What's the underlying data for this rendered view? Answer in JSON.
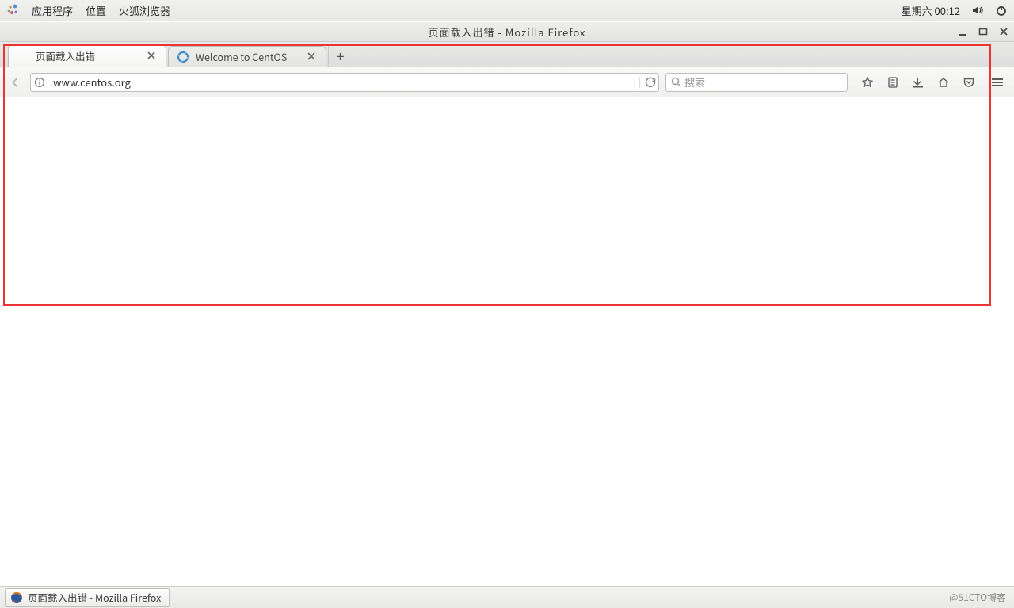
{
  "gnome": {
    "menu_applications": "应用程序",
    "menu_places": "位置",
    "menu_firefox": "火狐浏览器",
    "clock": "星期六 00:12"
  },
  "window": {
    "title": "页面载入出错  -  Mozilla Firefox"
  },
  "tabs": [
    {
      "title": "页面载入出错",
      "active": true,
      "favicon": "warning-icon"
    },
    {
      "title": "Welcome to CentOS",
      "active": false,
      "favicon": "centos-icon"
    }
  ],
  "urlbar": {
    "value": "www.centos.org"
  },
  "searchbar": {
    "placeholder": "搜索"
  },
  "taskbar": {
    "button_label": "页面载入出错 - Mozilla Firefox"
  },
  "watermark": "@51CTO博客"
}
